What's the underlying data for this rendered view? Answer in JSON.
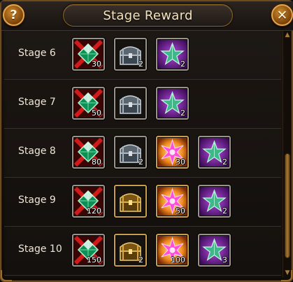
{
  "dialog": {
    "title": "Stage Reward",
    "help_label": "?",
    "close_label": "✕"
  },
  "item_types": {
    "cross-gem": {
      "label": "Red cross emerald token",
      "border": "#9a9488"
    },
    "silver-chest": {
      "label": "Silver treasure chest",
      "border": "#9a9488"
    },
    "gold-chest": {
      "label": "Gold treasure chest",
      "border": "#c9a04a"
    },
    "pink-star": {
      "label": "Pink starburst",
      "border": "#c9a04a"
    },
    "green-star": {
      "label": "Green star on purple",
      "border": "#9a9488"
    }
  },
  "stages": [
    {
      "label": "Stage 6",
      "rewards": [
        {
          "type": "cross-gem",
          "icon": "cross-gem-icon",
          "count": "30"
        },
        {
          "type": "silver-chest",
          "icon": "silver-chest-icon",
          "count": "2"
        },
        {
          "type": "green-star",
          "icon": "green-star-icon",
          "count": "2"
        }
      ]
    },
    {
      "label": "Stage 7",
      "rewards": [
        {
          "type": "cross-gem",
          "icon": "cross-gem-icon",
          "count": "50"
        },
        {
          "type": "silver-chest",
          "icon": "silver-chest-icon",
          "count": ""
        },
        {
          "type": "green-star",
          "icon": "green-star-icon",
          "count": "2"
        }
      ]
    },
    {
      "label": "Stage 8",
      "rewards": [
        {
          "type": "cross-gem",
          "icon": "cross-gem-icon",
          "count": "80"
        },
        {
          "type": "silver-chest",
          "icon": "silver-chest-icon",
          "count": "2"
        },
        {
          "type": "pink-star",
          "icon": "pink-star-icon",
          "count": "30"
        },
        {
          "type": "green-star",
          "icon": "green-star-icon",
          "count": "2"
        }
      ]
    },
    {
      "label": "Stage 9",
      "rewards": [
        {
          "type": "cross-gem",
          "icon": "cross-gem-icon",
          "count": "120"
        },
        {
          "type": "gold-chest",
          "icon": "gold-chest-icon",
          "count": ""
        },
        {
          "type": "pink-star",
          "icon": "pink-star-icon",
          "count": "50"
        },
        {
          "type": "green-star",
          "icon": "green-star-icon",
          "count": "2"
        }
      ]
    },
    {
      "label": "Stage 10",
      "rewards": [
        {
          "type": "cross-gem",
          "icon": "cross-gem-icon",
          "count": "150"
        },
        {
          "type": "gold-chest",
          "icon": "gold-chest-icon",
          "count": "2"
        },
        {
          "type": "pink-star",
          "icon": "pink-star-icon",
          "count": "100"
        },
        {
          "type": "green-star",
          "icon": "green-star-icon",
          "count": "3"
        }
      ]
    }
  ],
  "scrollbar": {
    "up_icon": "▲",
    "down_icon": "▼"
  }
}
